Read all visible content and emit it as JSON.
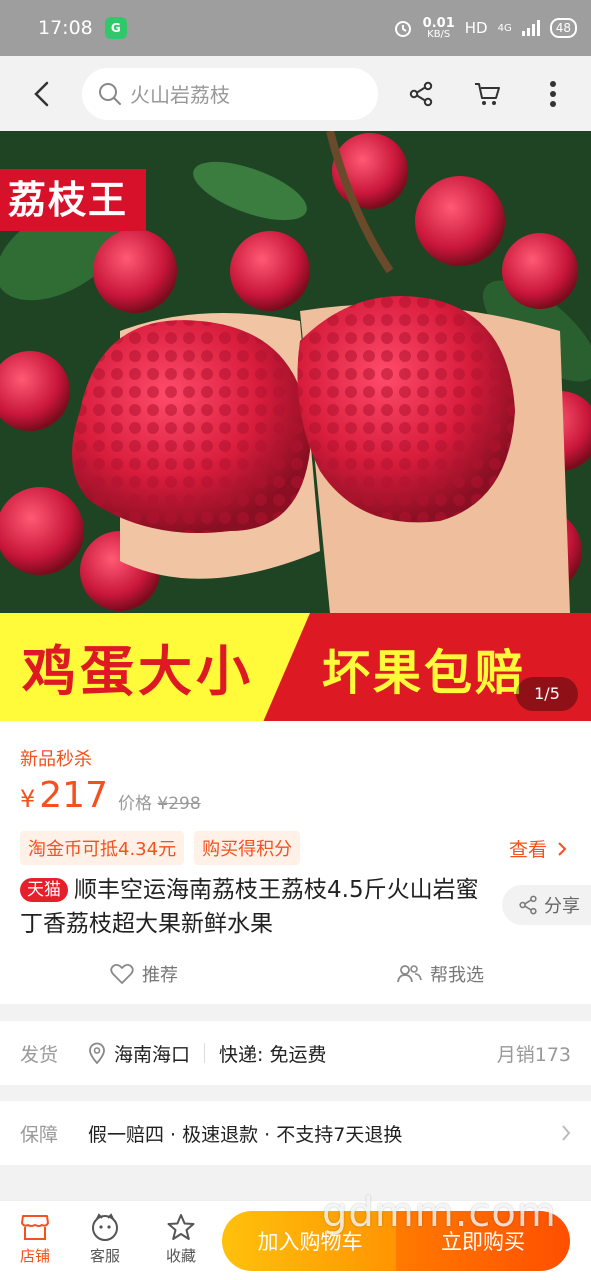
{
  "status_bar": {
    "time": "17:08",
    "app_badge": "G",
    "net_speed_value": "0.01",
    "net_speed_unit": "KB/S",
    "hd": "HD",
    "network": "4G",
    "battery": "48"
  },
  "nav": {
    "search_placeholder": "火山岩荔枝",
    "icons": [
      "back-icon",
      "search-icon",
      "share-icon",
      "cart-icon",
      "more-icon"
    ]
  },
  "hero": {
    "badge_top": "荔枝王",
    "banner_left": "鸡蛋大小",
    "banner_right": "坏果包赔",
    "counter": "1/5"
  },
  "product": {
    "promo_tag": "新品秒杀",
    "currency": "¥",
    "price": "217",
    "orig_label": "价格",
    "orig_currency": "¥",
    "orig_price": "298",
    "chips": [
      "淘金币可抵4.34元",
      "购买得积分"
    ],
    "view_more": "查看",
    "tmall_tag": "天猫",
    "title": "顺丰空运海南荔枝王荔枝4.5斤火山岩蜜丁香荔枝超大果新鲜水果",
    "share_label": "分享",
    "recommend_label": "推荐",
    "help_choose_label": "帮我选"
  },
  "shipping": {
    "label": "发货",
    "location": "海南海口",
    "express": "快递: 免运费",
    "monthly_sales": "月销173"
  },
  "guarantee": {
    "label": "保障",
    "text": "假一赔四 · 极速退款 · 不支持7天退换"
  },
  "bottom_bar": {
    "store_label": "店铺",
    "service_label": "客服",
    "favorite_label": "收藏",
    "add_to_cart": "加入购物车",
    "buy_now": "立即购买"
  },
  "watermark": "gdmm.com",
  "colors": {
    "accent": "#f4511e",
    "tmall_red": "#e61f2c",
    "cart_button": "#ffb300",
    "buy_button": "#ff5a00",
    "banner_yellow": "#fffb3a",
    "banner_red": "#dd1a24"
  }
}
